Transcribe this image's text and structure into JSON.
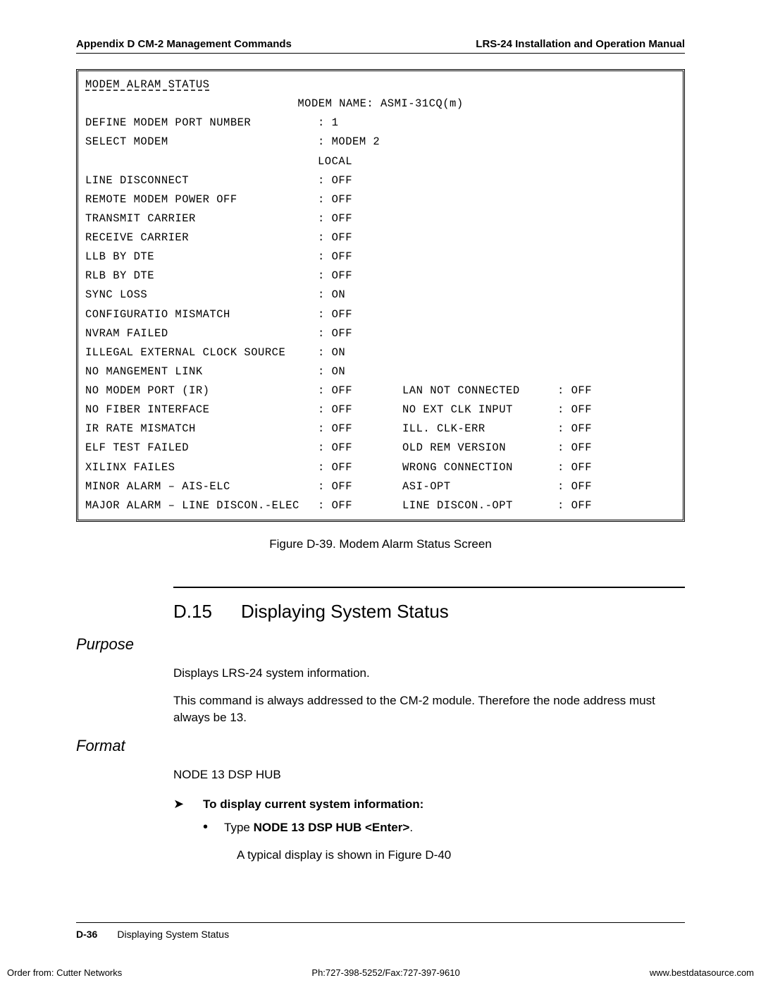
{
  "header": {
    "left": "Appendix D  CM-2 Management Commands",
    "right": "LRS-24 Installation and Operation Manual"
  },
  "screen": {
    "title": "MODEM ALRAM STATUS",
    "modemNameLabel": "MODEM NAME:",
    "modemName": "ASMI-31CQ(m)",
    "rows": [
      {
        "l": "DEFINE MODEM PORT NUMBER",
        "v": "1"
      },
      {
        "l": "SELECT MODEM",
        "v": "MODEM 2 LOCAL"
      },
      {
        "l": "LINE DISCONNECT",
        "v": "OFF"
      },
      {
        "l": "REMOTE MODEM POWER OFF",
        "v": "OFF"
      },
      {
        "l": "TRANSMIT CARRIER",
        "v": "OFF"
      },
      {
        "l": "RECEIVE CARRIER",
        "v": "OFF"
      },
      {
        "l": "LLB BY DTE",
        "v": "OFF"
      },
      {
        "l": "RLB BY DTE",
        "v": "OFF"
      },
      {
        "l": "SYNC LOSS",
        "v": "ON"
      },
      {
        "l": "CONFIGURATIO MISMATCH",
        "v": "OFF"
      },
      {
        "l": "NVRAM FAILED",
        "v": "OFF"
      },
      {
        "l": "ILLEGAL EXTERNAL CLOCK SOURCE",
        "v": "ON"
      },
      {
        "l": "NO MANGEMENT LINK",
        "v": "ON"
      },
      {
        "l": "NO MODEM PORT (IR)",
        "v": "OFF",
        "l2": "LAN NOT CONNECTED",
        "v2": "OFF"
      },
      {
        "l": "NO FIBER INTERFACE",
        "v": "OFF",
        "l2": "NO EXT CLK INPUT",
        "v2": "OFF"
      },
      {
        "l": "IR RATE MISMATCH",
        "v": "OFF",
        "l2": "ILL. CLK-ERR",
        "v2": "OFF"
      },
      {
        "l": "ELF TEST FAILED",
        "v": "OFF",
        "l2": "OLD REM VERSION",
        "v2": "OFF"
      },
      {
        "l": "XILINX FAILES",
        "v": "OFF",
        "l2": "WRONG CONNECTION",
        "v2": "OFF"
      },
      {
        "l": "MINOR ALARM – AIS-ELC",
        "v": "OFF",
        "l2": "ASI-OPT",
        "v2": "OFF"
      },
      {
        "l": "MAJOR ALARM – LINE DISCON.-ELEC",
        "v": "OFF",
        "l2": "LINE DISCON.-OPT",
        "v2": "OFF"
      }
    ]
  },
  "figureCaption": "Figure D-39.  Modem Alarm Status Screen",
  "section": {
    "num": "D.15",
    "title": "Displaying System Status",
    "purposeHeading": "Purpose",
    "purpose1": "Displays LRS-24 system information.",
    "purpose2": "This command is always addressed to the CM-2 module. Therefore the node address must always be 13.",
    "formatHeading": "Format",
    "formatCmd": "NODE 13 DSP HUB",
    "instr": "To display current system information:",
    "bulletPrefix": "Type ",
    "bulletBold": "NODE 13 DSP HUB <Enter>",
    "bulletSuffix": ".",
    "displayNote": "A typical display is shown in Figure D-40"
  },
  "pageFooter": {
    "num": "D-36",
    "title": "Displaying System Status"
  },
  "bottom": {
    "left": "Order from: Cutter Networks",
    "center": "Ph:727-398-5252/Fax:727-397-9610",
    "right": "www.bestdatasource.com"
  }
}
